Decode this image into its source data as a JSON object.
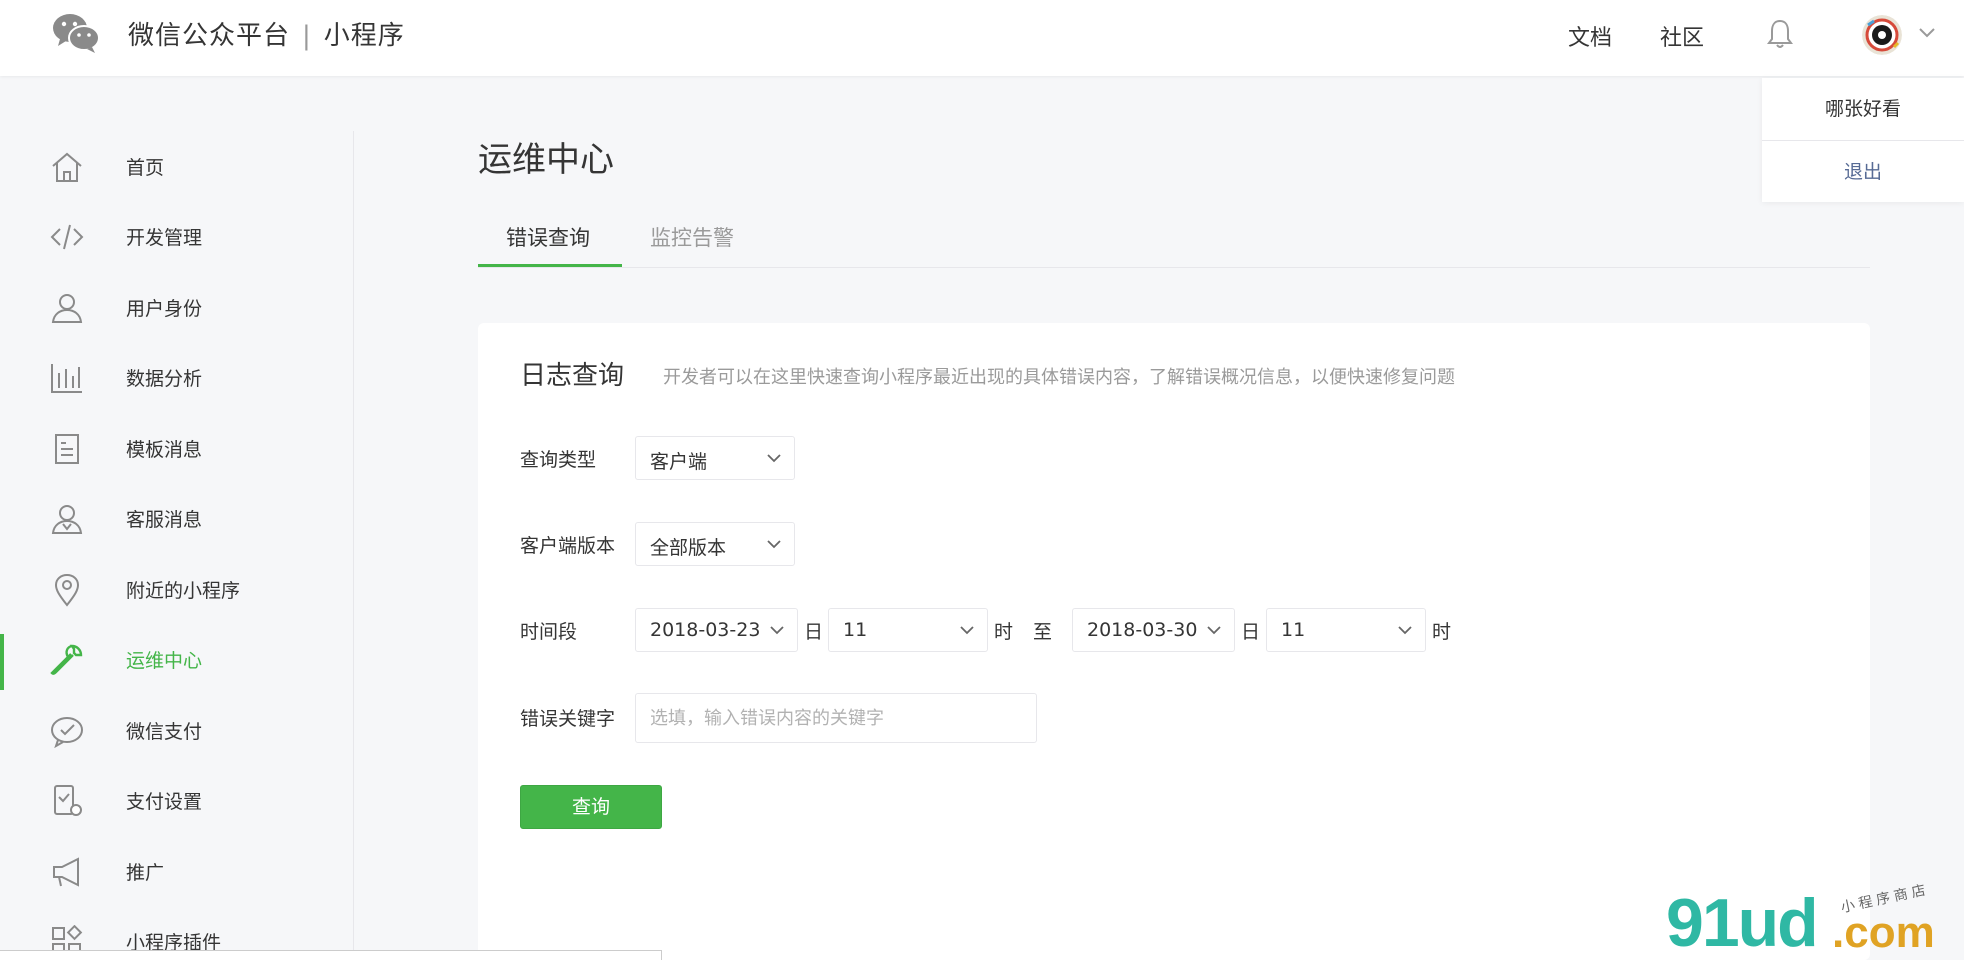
{
  "header": {
    "brand_main": "微信公众平台",
    "brand_separator": "|",
    "brand_sub": "小程序",
    "nav": [
      "文档",
      "社区"
    ]
  },
  "user_menu": {
    "items": [
      {
        "label": "哪张好看"
      },
      {
        "label": "退出"
      }
    ]
  },
  "sidebar": {
    "items": [
      {
        "label": "首页",
        "icon": "home-icon"
      },
      {
        "label": "开发管理",
        "icon": "code-icon"
      },
      {
        "label": "用户身份",
        "icon": "user-icon"
      },
      {
        "label": "数据分析",
        "icon": "chart-icon"
      },
      {
        "label": "模板消息",
        "icon": "document-icon"
      },
      {
        "label": "客服消息",
        "icon": "service-icon"
      },
      {
        "label": "附近的小程序",
        "icon": "location-icon"
      },
      {
        "label": "运维中心",
        "icon": "wrench-icon",
        "active": true
      },
      {
        "label": "微信支付",
        "icon": "wechat-pay-icon"
      },
      {
        "label": "支付设置",
        "icon": "pay-settings-icon"
      },
      {
        "label": "推广",
        "icon": "megaphone-icon"
      },
      {
        "label": "小程序插件",
        "icon": "plugin-icon"
      }
    ]
  },
  "main": {
    "title": "运维中心",
    "tabs": [
      {
        "label": "错误查询",
        "active": true
      },
      {
        "label": "监控告警",
        "active": false
      }
    ]
  },
  "log_query": {
    "title": "日志查询",
    "description": "开发者可以在这里快速查询小程序最近出现的具体错误内容，了解错误概况信息，以便快速修复问题",
    "query_type": {
      "label": "查询类型",
      "value": "客户端"
    },
    "client_version": {
      "label": "客户端版本",
      "value": "全部版本"
    },
    "time_range": {
      "label": "时间段",
      "start_date": "2018-03-23",
      "day_unit": "日",
      "start_hour": "11",
      "hour_unit": "时",
      "to": "至",
      "end_date": "2018-03-30",
      "end_hour": "11"
    },
    "keyword": {
      "label": "错误关键字",
      "placeholder": "选填，输入错误内容的关键字",
      "value": ""
    },
    "submit_label": "查询"
  },
  "watermark": {
    "main": "91ud",
    "suffix": ".com",
    "sub": "小程序商店"
  },
  "colors": {
    "accent": "#44b549",
    "link": "#576b95",
    "muted": "#9a9a9a"
  }
}
